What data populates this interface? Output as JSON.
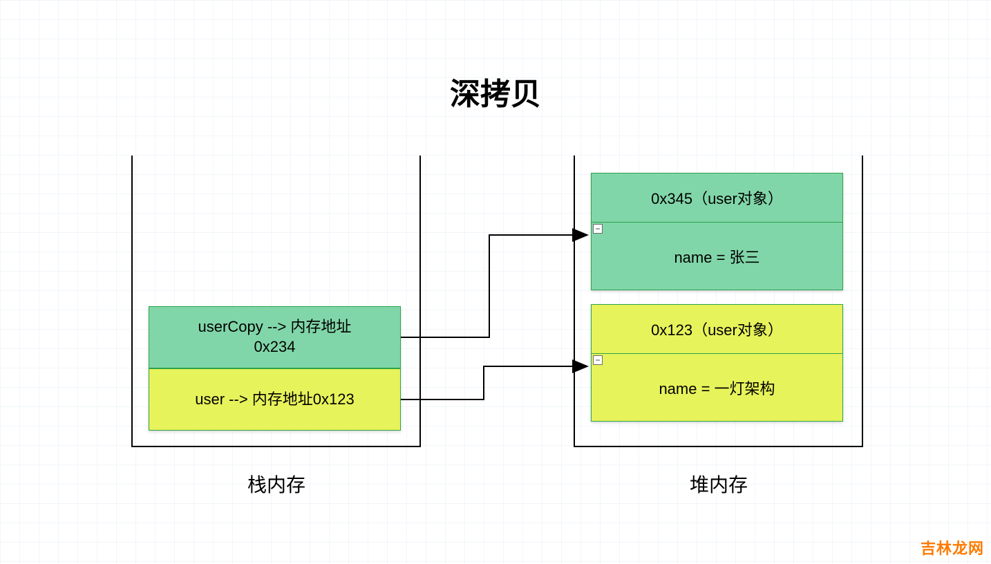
{
  "title": "深拷贝",
  "stack": {
    "label": "栈内存",
    "items": [
      {
        "line1": "userCopy --> 内存地址",
        "line2": "0x234",
        "color": "green"
      },
      {
        "line1": "user --> 内存地址0x123",
        "line2": "",
        "color": "yellow"
      }
    ]
  },
  "heap": {
    "label": "堆内存",
    "objects": [
      {
        "header": "0x345（user对象）",
        "field": "name = 张三",
        "color": "green"
      },
      {
        "header": "0x123（user对象）",
        "field": "name = 一灯架构",
        "color": "yellow"
      }
    ]
  },
  "collapse_glyph": "−",
  "watermark": "吉林龙网",
  "colors": {
    "green": "#81d6a9",
    "yellow": "#e7f35a",
    "border": "#2ba34a",
    "watermark": "#ff7a00"
  }
}
